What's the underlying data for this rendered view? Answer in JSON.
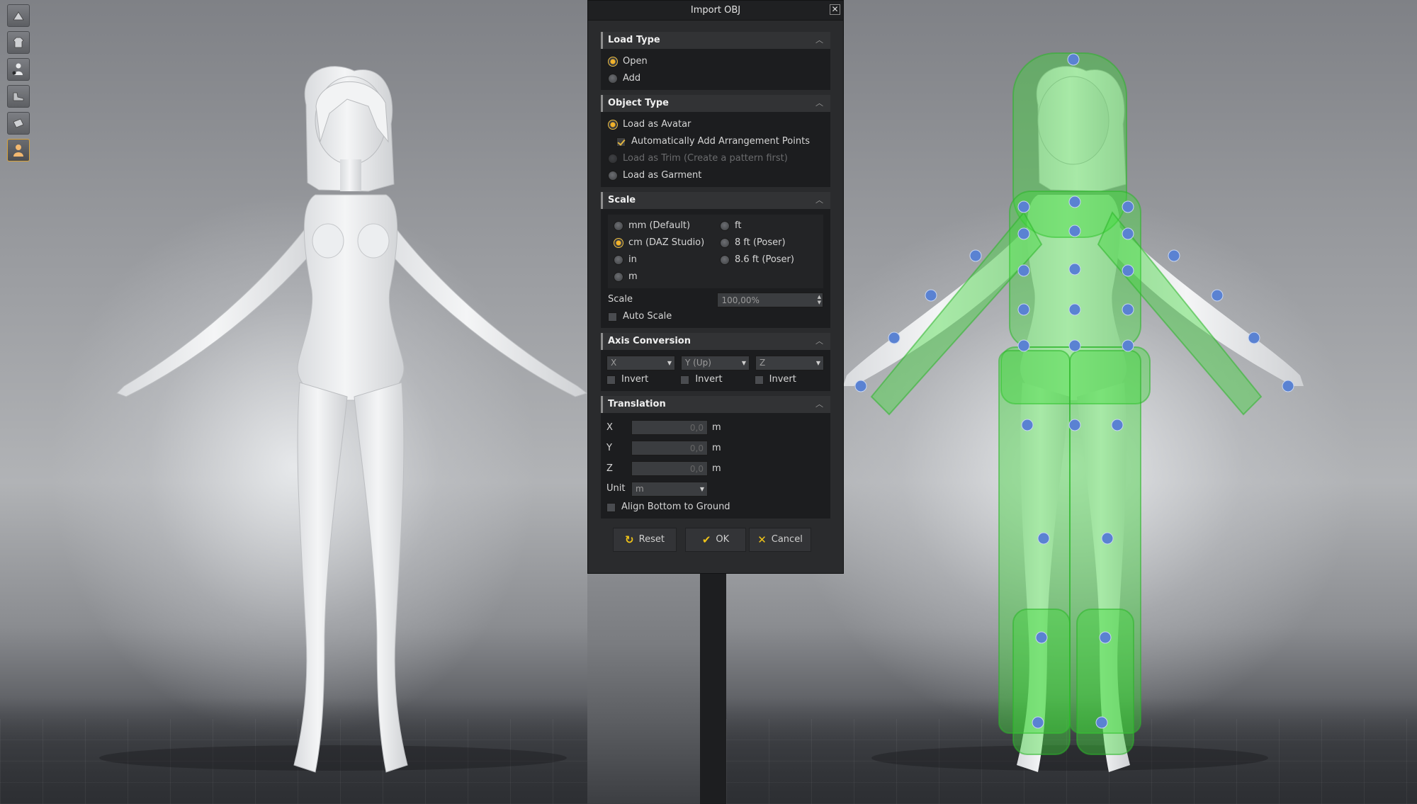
{
  "dialog": {
    "title": "Import OBJ",
    "close_glyph": "✕",
    "sections": {
      "load_type": {
        "title": "Load Type",
        "options": {
          "open": "Open",
          "add": "Add"
        },
        "selected": "Open"
      },
      "object_type": {
        "title": "Object Type",
        "options": {
          "avatar": "Load as Avatar",
          "arrangement": "Automatically Add Arrangement Points",
          "trim": "Load as Trim (Create a pattern first)",
          "garment": "Load as Garment"
        },
        "selected": "Load as Avatar",
        "arrangement_checked": true
      },
      "scale": {
        "title": "Scale",
        "units": {
          "mm": "mm (Default)",
          "cm": "cm (DAZ Studio)",
          "in": "in",
          "m": "m",
          "ft": "ft",
          "ft8": "8 ft (Poser)",
          "ft86": "8.6 ft (Poser)"
        },
        "selected_unit": "cm (DAZ Studio)",
        "scale_label": "Scale",
        "scale_value": "100,00%",
        "auto_scale_label": "Auto Scale",
        "auto_scale_checked": false
      },
      "axis_conversion": {
        "title": "Axis Conversion",
        "axes": {
          "x": "X",
          "y": "Y (Up)",
          "z": "Z"
        },
        "invert_label": "Invert"
      },
      "translation": {
        "title": "Translation",
        "x_label": "X",
        "y_label": "Y",
        "z_label": "Z",
        "x_value": "0,0",
        "y_value": "0,0",
        "z_value": "0,0",
        "unit_suffix": "m",
        "unit_label": "Unit",
        "unit_value": "m",
        "align_label": "Align Bottom to Ground",
        "align_checked": false
      }
    },
    "buttons": {
      "reset": "Reset",
      "ok": "OK",
      "cancel": "Cancel"
    }
  },
  "toolbar": {
    "icons": [
      "show-avatar-icon",
      "show-garment-icon",
      "show-arrangement-points-icon",
      "show-shoes-icon",
      "show-fabric-icon",
      "avatar-skin-icon"
    ]
  },
  "colors": {
    "accent": "#f2b32b",
    "bounding_volume": "#3ed63a",
    "arrangement_point": "#5a82d2"
  }
}
